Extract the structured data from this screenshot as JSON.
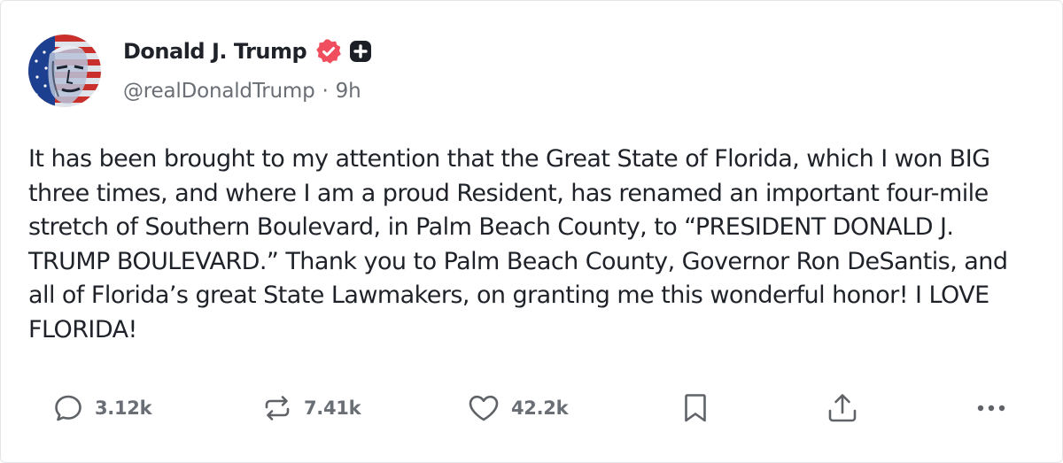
{
  "post": {
    "author": {
      "display_name": "Donald J. Trump",
      "handle": "@realDonaldTrump",
      "verified": true,
      "badge_icon": "plus-badge-icon",
      "verified_color": "#f04e5e"
    },
    "separator": "·",
    "timestamp": "9h",
    "body": "It has been brought to my attention that the Great State of Florida, which I won BIG three times, and where I am a proud Resident, has renamed an important four-mile stretch of Southern Boulevard, in Palm Beach County, to “PRESIDENT DONALD J. TRUMP BOULEVARD.” Thank you to Palm Beach County, Governor Ron DeSantis, and all of Florida’s great State Lawmakers, on granting me this wonderful honor! I LOVE FLORIDA!"
  },
  "actions": {
    "reply": {
      "icon": "comment-icon",
      "count": "3.12k"
    },
    "restruth": {
      "icon": "repost-icon",
      "count": "7.41k"
    },
    "like": {
      "icon": "heart-icon",
      "count": "42.2k"
    },
    "save": {
      "icon": "bookmark-icon"
    },
    "share": {
      "icon": "share-icon"
    },
    "more": {
      "icon": "more-icon"
    }
  },
  "colors": {
    "text": "#1f2329",
    "muted": "#6a6e75",
    "icon": "#5f6368",
    "border": "#e3e5e8"
  }
}
